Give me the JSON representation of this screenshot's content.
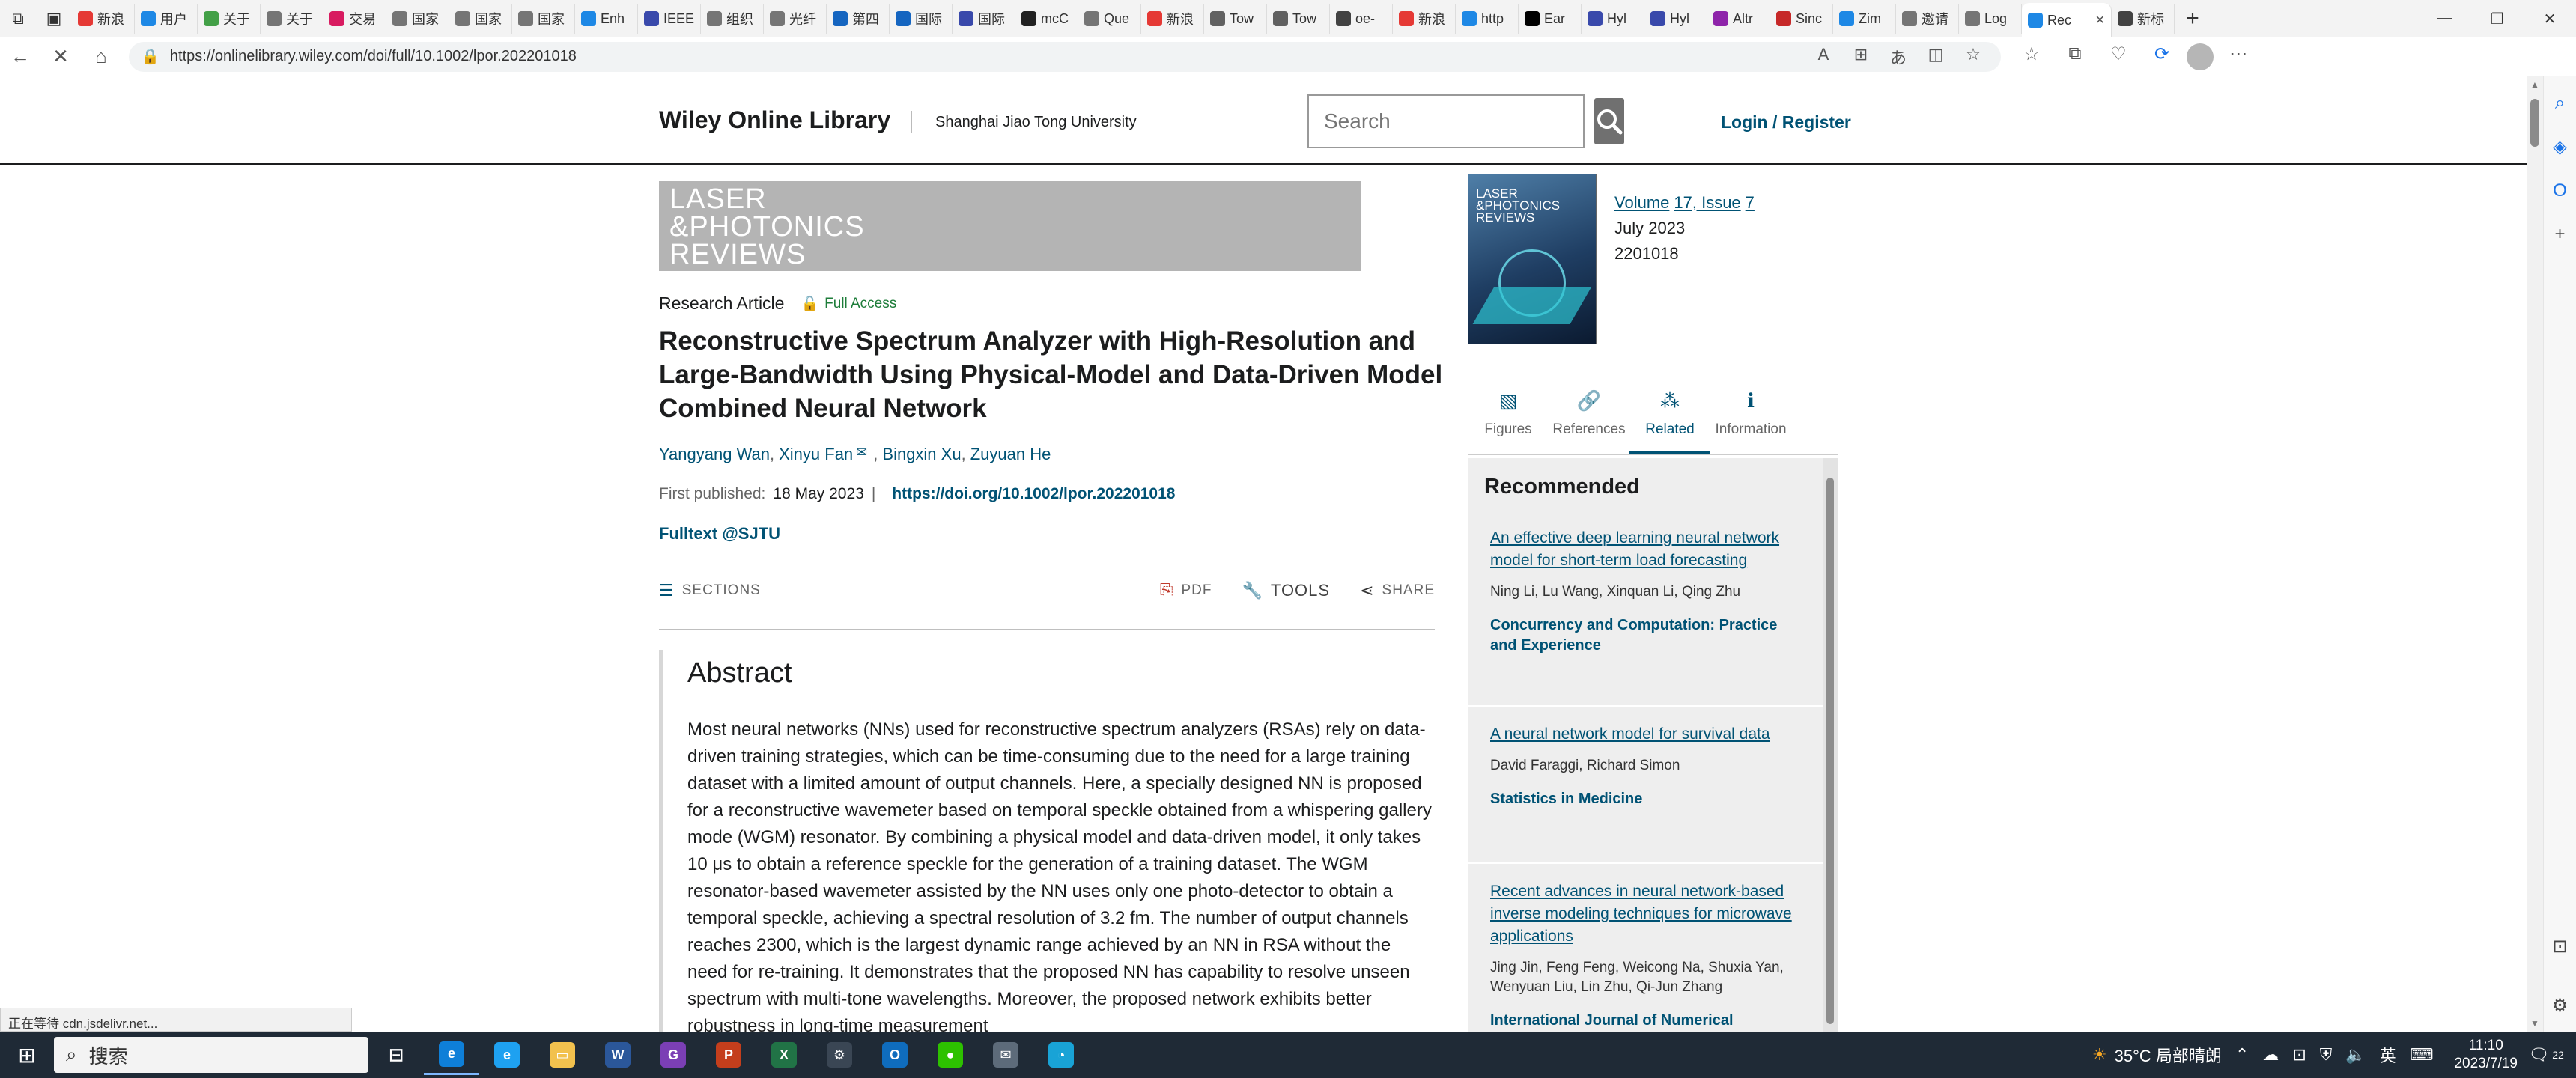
{
  "browser": {
    "tabs": [
      {
        "label": "新浪",
        "color": "#e53935"
      },
      {
        "label": "用户",
        "color": "#1e88e5"
      },
      {
        "label": "关于",
        "color": "#43a047"
      },
      {
        "label": "关于",
        "color": "#757575"
      },
      {
        "label": "交易",
        "color": "#d81b60"
      },
      {
        "label": "国家",
        "color": "#757575"
      },
      {
        "label": "国家",
        "color": "#757575"
      },
      {
        "label": "国家",
        "color": "#757575"
      },
      {
        "label": "Enh",
        "color": "#1e88e5"
      },
      {
        "label": "IEEE",
        "color": "#3949ab"
      },
      {
        "label": "组织",
        "color": "#757575"
      },
      {
        "label": "光纤",
        "color": "#757575"
      },
      {
        "label": "第四",
        "color": "#1565c0"
      },
      {
        "label": "国际",
        "color": "#1565c0"
      },
      {
        "label": "国际",
        "color": "#3949ab"
      },
      {
        "label": "mcC",
        "color": "#212121"
      },
      {
        "label": "Que",
        "color": "#757575"
      },
      {
        "label": "新浪",
        "color": "#e53935"
      },
      {
        "label": "Tow",
        "color": "#616161"
      },
      {
        "label": "Tow",
        "color": "#616161"
      },
      {
        "label": "oe-",
        "color": "#424242"
      },
      {
        "label": "新浪",
        "color": "#e53935"
      },
      {
        "label": "http",
        "color": "#1e88e5"
      },
      {
        "label": "Ear",
        "color": "#000000"
      },
      {
        "label": "Hyl",
        "color": "#3949ab"
      },
      {
        "label": "Hyl",
        "color": "#3949ab"
      },
      {
        "label": "Altr",
        "color": "#8e24aa"
      },
      {
        "label": "Sinc",
        "color": "#c62828"
      },
      {
        "label": "Zim",
        "color": "#1e88e5"
      },
      {
        "label": "邀请",
        "color": "#757575"
      },
      {
        "label": "Log",
        "color": "#757575"
      },
      {
        "label": "Rec",
        "color": "#1e88e5"
      },
      {
        "label": "新标",
        "color": "#424242"
      }
    ],
    "active_tab_close": "✕",
    "url": "https://onlinelibrary.wiley.com/doi/full/10.1002/lpor.202201018",
    "status_text": "正在等待 cdn.jsdelivr.net..."
  },
  "site": {
    "logo": "Wiley Online Library",
    "institution": "Shanghai Jiao Tong University",
    "search_placeholder": "Search",
    "login": "Login / Register"
  },
  "journal": {
    "banner_lines": [
      "LASER",
      "&PHOTONICS",
      "REVIEWS"
    ],
    "cover_lines": [
      "LASER",
      "&PHOTONICS",
      "REVIEWS"
    ],
    "volume_label": "Volume",
    "volume": "17, Issue",
    "issue": "7",
    "date": "July 2023",
    "article_number": "2201018"
  },
  "article": {
    "type": "Research Article",
    "access": "Full Access",
    "title": "Reconstructive Spectrum Analyzer with High-Resolution and Large-Bandwidth Using Physical-Model and Data-Driven Model Combined Neural Network",
    "authors": [
      "Yangyang Wan",
      "Xinyu Fan",
      "Bingxin Xu",
      "Zuyuan He"
    ],
    "published_label": "First published:",
    "published_date": "18 May 2023",
    "doi": "https://doi.org/10.1002/lpor.202201018",
    "fulltext": "Fulltext @SJTU"
  },
  "toolbar": {
    "sections": "SECTIONS",
    "pdf": "PDF",
    "tools": "TOOLS",
    "share": "SHARE"
  },
  "abstract": {
    "heading": "Abstract",
    "text": "Most neural networks (NNs) used for reconstructive spectrum analyzers (RSAs) rely on data-driven training strategies, which can be time-consuming due to the need for a large training dataset with a limited amount of output channels. Here, a specially designed NN is proposed for a reconstructive wavemeter based on temporal speckle obtained from a whispering gallery mode (WGM) resonator. By combining a physical model and data-driven model, it only takes 10 μs to obtain a reference speckle for the generation of a training dataset. The WGM resonator-based wavemeter assisted by the NN uses only one photo-detector to obtain a temporal speckle, achieving a spectral resolution of 3.2 fm. The number of output channels reaches 2300, which is the largest dynamic range achieved by an NN in RSA without the need for re-training. It demonstrates that the proposed NN has capability to resolve unseen spectrum with multi-tone wavelengths. Moreover, the proposed network exhibits better robustness in long-time measurement"
  },
  "side_tabs": [
    {
      "label": "Figures",
      "icon": "image-icon",
      "glyph": "▧"
    },
    {
      "label": "References",
      "icon": "link-icon",
      "glyph": "🔗"
    },
    {
      "label": "Related",
      "icon": "related-icon",
      "glyph": "⁂",
      "active": true
    },
    {
      "label": "Information",
      "icon": "info-icon",
      "glyph": "ℹ"
    }
  ],
  "recommended": {
    "heading": "Recommended",
    "items": [
      {
        "title": "An effective deep learning neural network model for short-term load forecasting",
        "authors": "Ning Li, Lu Wang, Xinquan Li, Qing Zhu",
        "journal": "Concurrency and Computation: Practice and Experience"
      },
      {
        "title": "A neural network model for survival data",
        "authors": "David Faraggi, Richard Simon",
        "journal": "Statistics in Medicine"
      },
      {
        "title": "Recent advances in neural network-based inverse modeling techniques for microwave applications",
        "authors": "Jing Jin, Feng Feng, Weicong Na, Shuxia Yan, Wenyuan Liu, Lin Zhu, Qi-Jun Zhang",
        "journal": "International Journal of Numerical Modelling: Electronic Networks, Devices and Fields"
      }
    ]
  },
  "taskbar": {
    "search": "搜索",
    "weather": "35°C 局部晴朗",
    "lang": "英",
    "time": "11:10",
    "date": "2023/7/19",
    "notif_count": "22",
    "apps": [
      {
        "name": "edge",
        "color": "#0e7fd8",
        "glyph": "e"
      },
      {
        "name": "ie",
        "color": "#1ea1f1",
        "glyph": "e"
      },
      {
        "name": "explorer",
        "color": "#f2c14e",
        "glyph": "▭"
      },
      {
        "name": "word",
        "color": "#2b579a",
        "glyph": "W"
      },
      {
        "name": "app-g",
        "color": "#7b3fb5",
        "glyph": "G"
      },
      {
        "name": "powerpoint",
        "color": "#c43e1c",
        "glyph": "P"
      },
      {
        "name": "excel",
        "color": "#217346",
        "glyph": "X"
      },
      {
        "name": "settings",
        "color": "#3a4654",
        "glyph": "⚙"
      },
      {
        "name": "outlook",
        "color": "#0f6cbd",
        "glyph": "O"
      },
      {
        "name": "wechat",
        "color": "#2dc100",
        "glyph": "●"
      },
      {
        "name": "mail",
        "color": "#5d6b7a",
        "glyph": "✉"
      },
      {
        "name": "app-blue",
        "color": "#19a3d6",
        "glyph": "◔"
      }
    ]
  },
  "colors": {
    "link": "#005274",
    "access": "#1e7d3a",
    "taskbar": "#1f2a36"
  }
}
